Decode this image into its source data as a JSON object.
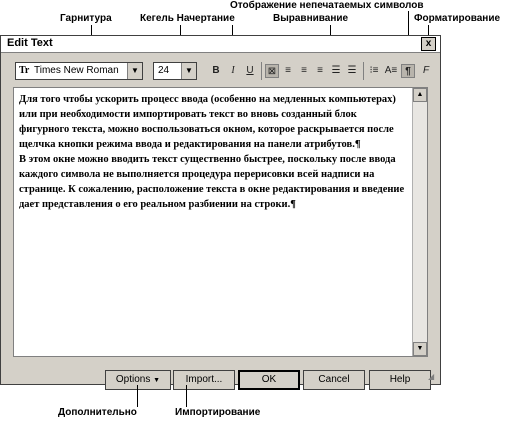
{
  "callouts": {
    "typeface": "Гарнитура",
    "size_style": "Кегель Начертание",
    "nonprinting": "Отображение непечатаемых символов",
    "alignment": "Выравнивание",
    "formatting": "Форматирование",
    "options": "Дополнительно",
    "import": "Импортирование"
  },
  "window": {
    "title": "Edit Text",
    "close": "x"
  },
  "toolbar": {
    "font_family": "Times New Roman",
    "font_size": "24",
    "font_icon": "Tr",
    "bold": "B",
    "italic": "I",
    "underline": "U"
  },
  "text": {
    "paragraph1": "Для того чтобы ускорить процесс ввода (особенно на медленных компьютерах) или при необходимости импортировать текст во вновь созданный блок фигурного текста, можно воспользоваться окном, которое раскрывается после щелчка кнопки режима ввода и редактирования на панели атрибутов.¶",
    "paragraph2": "В этом окне можно вводить текст существенно быстрее, поскольку после ввода каждого символа не выполняется процедура перерисовки всей надписи на странице. К сожалению, расположение текста в окне редактирования и введение дает представления о его реальном разбиении на строки.¶"
  },
  "buttons": {
    "options": "Options",
    "import": "Import...",
    "ok": "OK",
    "cancel": "Cancel",
    "help": "Help"
  }
}
